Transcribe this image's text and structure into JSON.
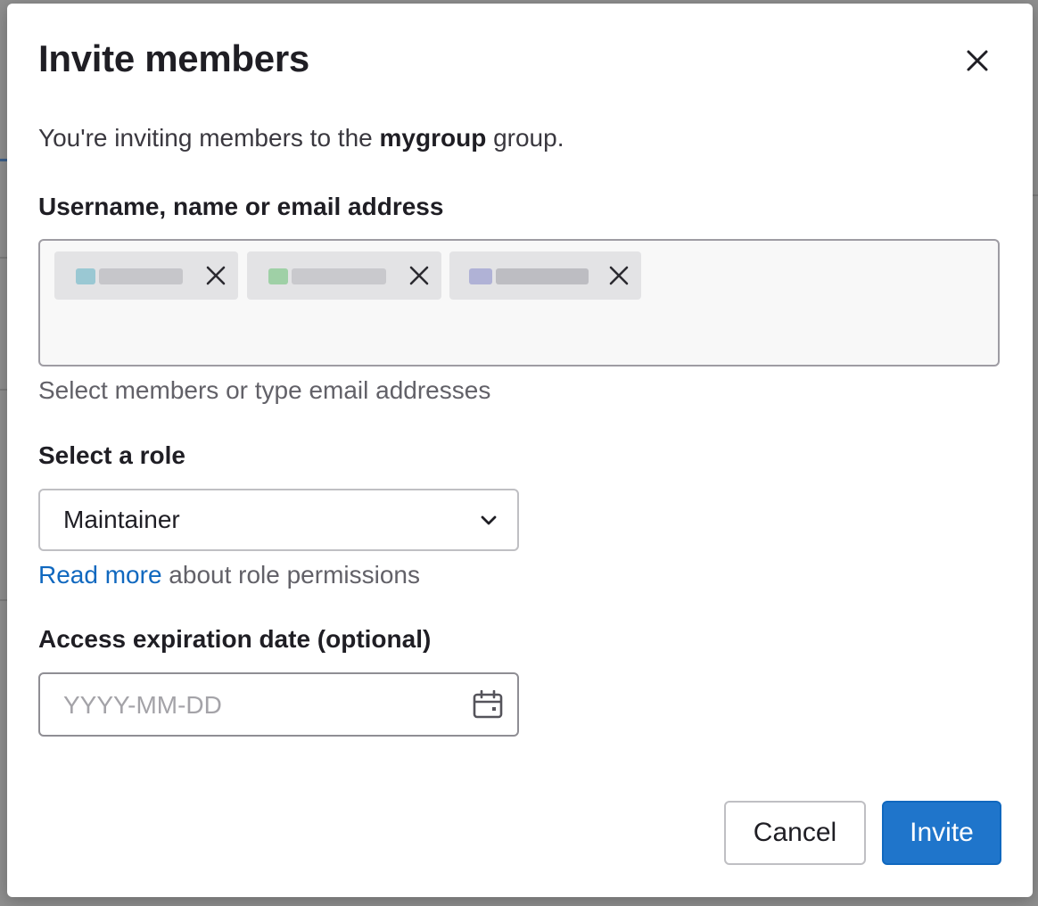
{
  "modal": {
    "title": "Invite members",
    "intro_prefix": "You're inviting members to the ",
    "group_name": "mygroup",
    "intro_suffix": " group.",
    "close_icon": "close-icon"
  },
  "members_field": {
    "label": "Username, name or email address",
    "help_text": "Select members or type email addresses",
    "tokens": [
      {
        "remove_icon": "close-icon"
      },
      {
        "remove_icon": "close-icon"
      },
      {
        "remove_icon": "close-icon"
      }
    ]
  },
  "role_field": {
    "label": "Select a role",
    "selected": "Maintainer",
    "link_text": "Read more",
    "link_suffix": " about role permissions"
  },
  "expiration_field": {
    "label": "Access expiration date (optional)",
    "placeholder": "YYYY-MM-DD",
    "value": ""
  },
  "actions": {
    "cancel_label": "Cancel",
    "invite_label": "Invite"
  },
  "colors": {
    "accent": "#1f75cb",
    "link": "#1068bf"
  }
}
